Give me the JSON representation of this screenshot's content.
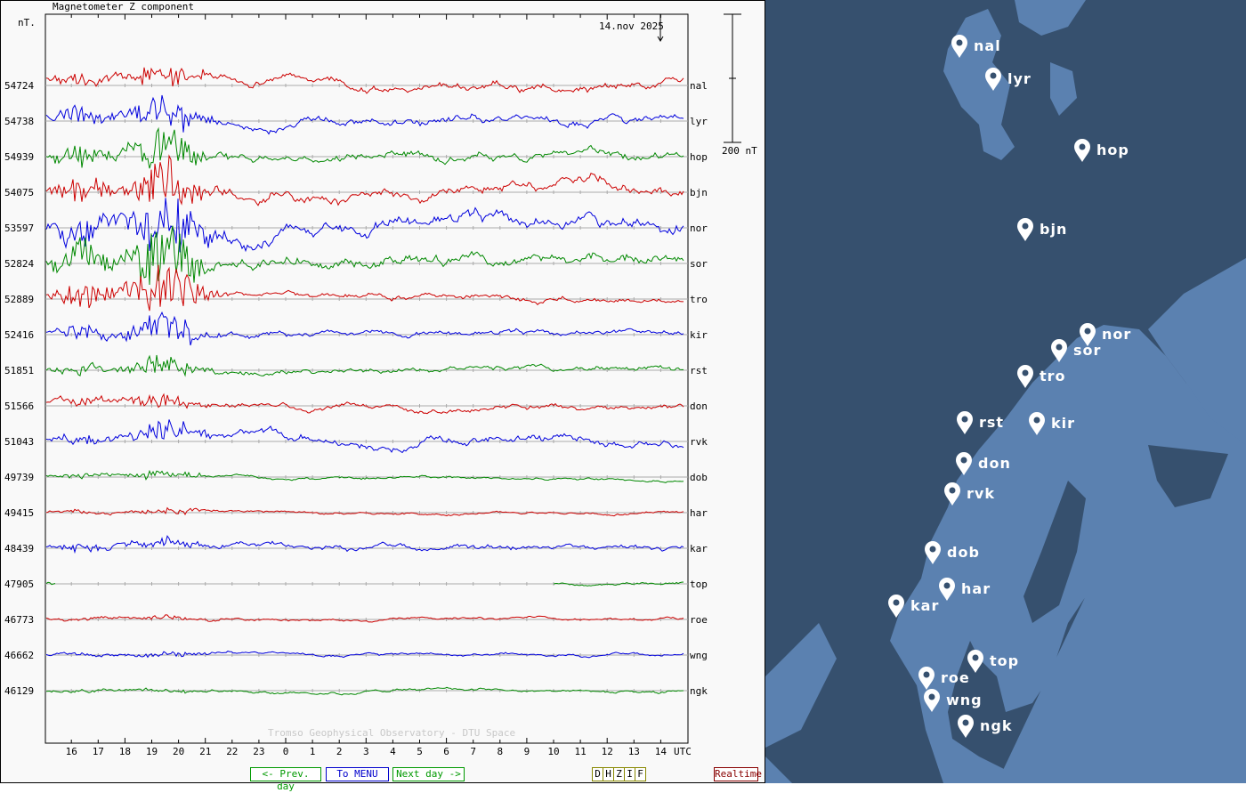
{
  "chart_data": {
    "type": "line",
    "title": "Magnetometer Z component",
    "ylabel": "nT.",
    "date_label": "14.nov 2025",
    "scale_label": "200 nT",
    "credit": "Tromso Geophysical Observatory - DTU Space",
    "xlabel": "UTC",
    "x_ticks": [
      "16",
      "17",
      "18",
      "19",
      "20",
      "21",
      "22",
      "23",
      "0",
      "1",
      "2",
      "3",
      "4",
      "5",
      "6",
      "7",
      "8",
      "9",
      "10",
      "11",
      "12",
      "13",
      "14"
    ],
    "series": [
      {
        "name": "nal",
        "baseline": "54724",
        "color": "#cc0000",
        "seed": 1,
        "noise": 3,
        "storm": 18,
        "shift": -14
      },
      {
        "name": "lyr",
        "baseline": "54738",
        "color": "#0000dd",
        "seed": 2,
        "noise": 3,
        "storm": 22,
        "shift": -6
      },
      {
        "name": "hop",
        "baseline": "54939",
        "color": "#008800",
        "seed": 3,
        "noise": 3,
        "storm": 30,
        "shift": 0
      },
      {
        "name": "bjn",
        "baseline": "54075",
        "color": "#cc0000",
        "seed": 4,
        "noise": 4,
        "storm": 35,
        "shift": 0
      },
      {
        "name": "nor",
        "baseline": "53597",
        "color": "#0000dd",
        "seed": 5,
        "noise": 5,
        "storm": 45,
        "shift": -5
      },
      {
        "name": "sor",
        "baseline": "52824",
        "color": "#008800",
        "seed": 6,
        "noise": 4,
        "storm": 50,
        "shift": 0
      },
      {
        "name": "tro",
        "baseline": "52889",
        "color": "#cc0000",
        "seed": 7,
        "noise": 2,
        "storm": 40,
        "shift": -4
      },
      {
        "name": "kir",
        "baseline": "52416",
        "color": "#0000dd",
        "seed": 8,
        "noise": 2,
        "storm": 25,
        "shift": -5
      },
      {
        "name": "rst",
        "baseline": "51851",
        "color": "#008800",
        "seed": 9,
        "noise": 2,
        "storm": 15,
        "shift": 0
      },
      {
        "name": "don",
        "baseline": "51566",
        "color": "#cc0000",
        "seed": 10,
        "noise": 2,
        "storm": 10,
        "shift": -5
      },
      {
        "name": "rvk",
        "baseline": "51043",
        "color": "#0000dd",
        "seed": 11,
        "noise": 3,
        "storm": 10,
        "shift": -5
      },
      {
        "name": "dob",
        "baseline": "49739",
        "color": "#008800",
        "seed": 12,
        "noise": 1,
        "storm": 6,
        "shift": -2
      },
      {
        "name": "har",
        "baseline": "49415",
        "color": "#cc0000",
        "seed": 13,
        "noise": 1,
        "storm": 4,
        "shift": -1
      },
      {
        "name": "kar",
        "baseline": "48439",
        "color": "#0000dd",
        "seed": 14,
        "noise": 2,
        "storm": 6,
        "shift": -3
      },
      {
        "name": "top",
        "baseline": "47905",
        "color": "#008800",
        "seed": 15,
        "noise": 1,
        "storm": 0,
        "shift": 0,
        "gap": true
      },
      {
        "name": "roe",
        "baseline": "46773",
        "color": "#cc0000",
        "seed": 16,
        "noise": 1,
        "storm": 2,
        "shift": -1
      },
      {
        "name": "wng",
        "baseline": "46662",
        "color": "#0000dd",
        "seed": 17,
        "noise": 1,
        "storm": 2,
        "shift": -1
      },
      {
        "name": "ngk",
        "baseline": "46129",
        "color": "#008800",
        "seed": 18,
        "noise": 1,
        "storm": 1,
        "shift": 0
      }
    ]
  },
  "buttons": {
    "prev": "<- Prev. day",
    "menu": "To MENU",
    "next": "Next day ->",
    "d": "D",
    "h": "H",
    "z": "Z",
    "i": "I",
    "f": "F",
    "realtime": "Realtime"
  },
  "map": {
    "colors": {
      "sea": "#36506e",
      "land": "#5b81b0"
    },
    "stations": [
      "nal",
      "lyr",
      "hop",
      "bjn",
      "nor",
      "sor",
      "tro",
      "kir",
      "rst",
      "don",
      "rvk",
      "dob",
      "har",
      "kar",
      "top",
      "roe",
      "wng",
      "ngk"
    ]
  }
}
